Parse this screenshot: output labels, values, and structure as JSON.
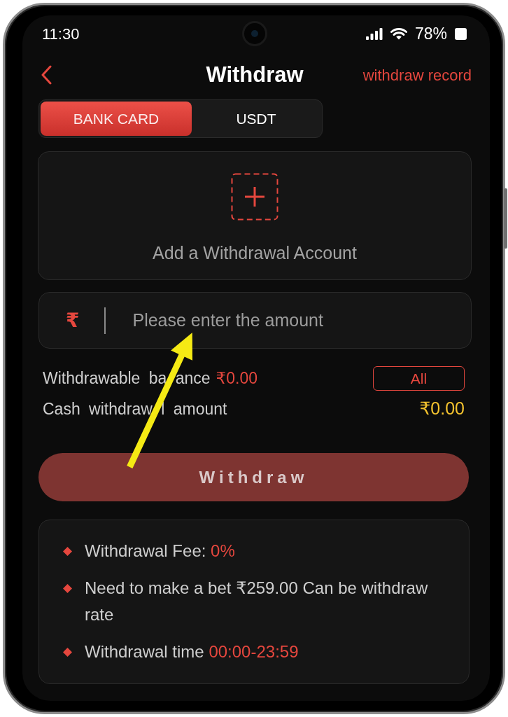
{
  "status_bar": {
    "time": "11:30",
    "battery": "78%"
  },
  "header": {
    "title": "Withdraw",
    "link": "withdraw record"
  },
  "tabs": [
    {
      "label": "BANK CARD",
      "selected": true
    },
    {
      "label": "USDT",
      "selected": false
    }
  ],
  "account_card": {
    "label": "Add a Withdrawal Account"
  },
  "amount_field": {
    "currency": "₹",
    "placeholder": "Please enter the amount"
  },
  "balance": {
    "label": "Withdrawable ba ance",
    "value": "₹0.00",
    "all_button": "All"
  },
  "cash_amount": {
    "label": "Cash withdraw l amount",
    "value": "₹0.00"
  },
  "withdraw_button": {
    "label": "Withdraw",
    "disabled": true
  },
  "rules": [
    {
      "text": "Withdrawal Fee:",
      "highlight": "0%"
    },
    {
      "text": "Need to make a bet ₹259.00 Can be withdraw rate"
    },
    {
      "text": "Withdrawal time",
      "highlight": "00:00-23:59"
    }
  ]
}
